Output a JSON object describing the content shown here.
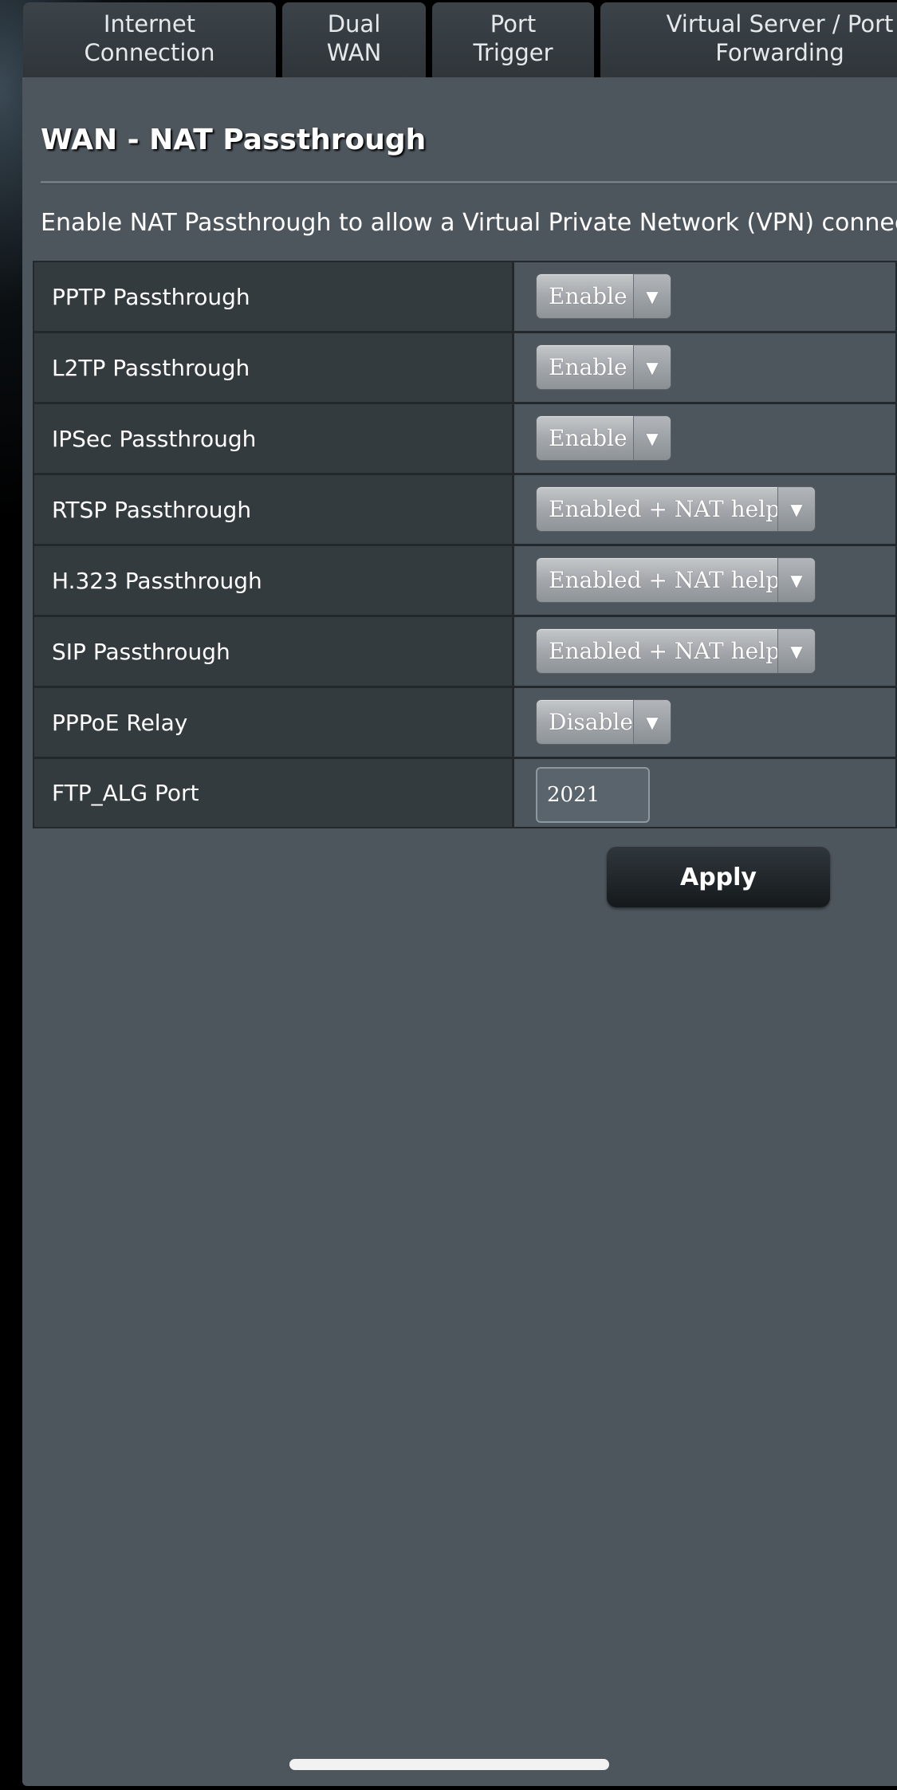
{
  "tabs": [
    {
      "label": "Internet\nConnection"
    },
    {
      "label": "Dual\nWAN"
    },
    {
      "label": "Port\nTrigger"
    },
    {
      "label": "Virtual Server / Port\nForwarding"
    }
  ],
  "page": {
    "title": "WAN - NAT Passthrough",
    "description": "Enable NAT Passthrough to allow a Virtual Private Network (VPN) connection to pass through the router"
  },
  "settings": [
    {
      "label": "PPTP Passthrough",
      "type": "select",
      "value": "Enable",
      "icon": "triangle-down-icon"
    },
    {
      "label": "L2TP Passthrough",
      "type": "select",
      "value": "Enable",
      "icon": "triangle-down-icon"
    },
    {
      "label": "IPSec Passthrough",
      "type": "select",
      "value": "Enable",
      "icon": "triangle-down-icon"
    },
    {
      "label": "RTSP Passthrough",
      "type": "select",
      "value": "Enabled + NAT helper",
      "icon": "triangle-down-icon"
    },
    {
      "label": "H.323 Passthrough",
      "type": "select",
      "value": "Enabled + NAT helper",
      "icon": "triangle-down-icon"
    },
    {
      "label": "SIP Passthrough",
      "type": "select",
      "value": "Enabled + NAT helper",
      "icon": "triangle-down-icon"
    },
    {
      "label": "PPPoE Relay",
      "type": "select",
      "value": "Disable",
      "icon": "triangle-down-icon"
    },
    {
      "label": "FTP_ALG Port",
      "type": "input",
      "value": "2021"
    }
  ],
  "actions": {
    "apply_label": "Apply"
  },
  "colors": {
    "panel": "#4e565d",
    "label_cell": "#343b3f",
    "tab": "#353c41",
    "button": "#1c2125"
  }
}
